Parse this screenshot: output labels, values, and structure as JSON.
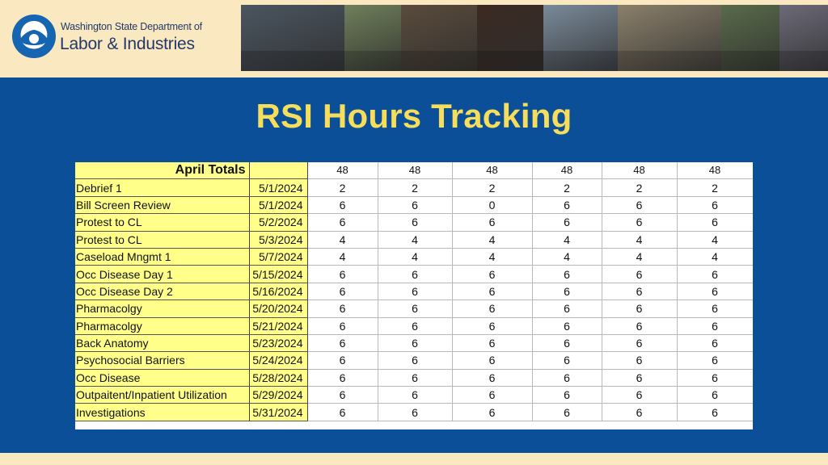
{
  "header": {
    "logo_line1": "Washington State Department of",
    "logo_line2": "Labor & Industries",
    "brand_color": "#1565b0",
    "photos": [
      "#4b5560",
      "#6f7f5a",
      "#5a4b3c",
      "#3b2a22",
      "#7a8a9a",
      "#8a7f6a",
      "#596b4a",
      "#6d6a78"
    ]
  },
  "title": "RSI Hours Tracking",
  "table": {
    "header": {
      "label": "April Totals",
      "date": "",
      "values": [
        "48",
        "48",
        "48",
        "48",
        "48",
        "48"
      ]
    },
    "rows": [
      {
        "name": "Debrief 1",
        "date": "5/1/2024",
        "values": [
          "2",
          "2",
          "2",
          "2",
          "2",
          "2"
        ]
      },
      {
        "name": "Bill Screen Review",
        "date": "5/1/2024",
        "values": [
          "6",
          "6",
          "0",
          "6",
          "6",
          "6"
        ]
      },
      {
        "name": "Protest to CL",
        "date": "5/2/2024",
        "values": [
          "6",
          "6",
          "6",
          "6",
          "6",
          "6"
        ]
      },
      {
        "name": "Protest to CL",
        "date": "5/3/2024",
        "values": [
          "4",
          "4",
          "4",
          "4",
          "4",
          "4"
        ]
      },
      {
        "name": "Caseload Mngmt 1",
        "date": "5/7/2024",
        "values": [
          "4",
          "4",
          "4",
          "4",
          "4",
          "4"
        ]
      },
      {
        "name": "Occ Disease Day 1",
        "date": "5/15/2024",
        "values": [
          "6",
          "6",
          "6",
          "6",
          "6",
          "6"
        ]
      },
      {
        "name": "Occ Disease Day 2",
        "date": "5/16/2024",
        "values": [
          "6",
          "6",
          "6",
          "6",
          "6",
          "6"
        ]
      },
      {
        "name": "Pharmacolgy",
        "date": "5/20/2024",
        "values": [
          "6",
          "6",
          "6",
          "6",
          "6",
          "6"
        ]
      },
      {
        "name": "Pharmacolgy",
        "date": "5/21/2024",
        "values": [
          "6",
          "6",
          "6",
          "6",
          "6",
          "6"
        ]
      },
      {
        "name": "Back Anatomy",
        "date": "5/23/2024",
        "values": [
          "6",
          "6",
          "6",
          "6",
          "6",
          "6"
        ]
      },
      {
        "name": "Psychosocial Barriers",
        "date": "5/24/2024",
        "values": [
          "6",
          "6",
          "6",
          "6",
          "6",
          "6"
        ]
      },
      {
        "name": "Occ Disease",
        "date": "5/28/2024",
        "values": [
          "6",
          "6",
          "6",
          "6",
          "6",
          "6"
        ]
      },
      {
        "name": "Outpaitent/Inpatient Utilization",
        "date": "5/29/2024",
        "values": [
          "6",
          "6",
          "6",
          "6",
          "6",
          "6"
        ]
      },
      {
        "name": "Investigations",
        "date": "5/31/2024",
        "values": [
          "6",
          "6",
          "6",
          "6",
          "6",
          "6"
        ]
      }
    ]
  }
}
